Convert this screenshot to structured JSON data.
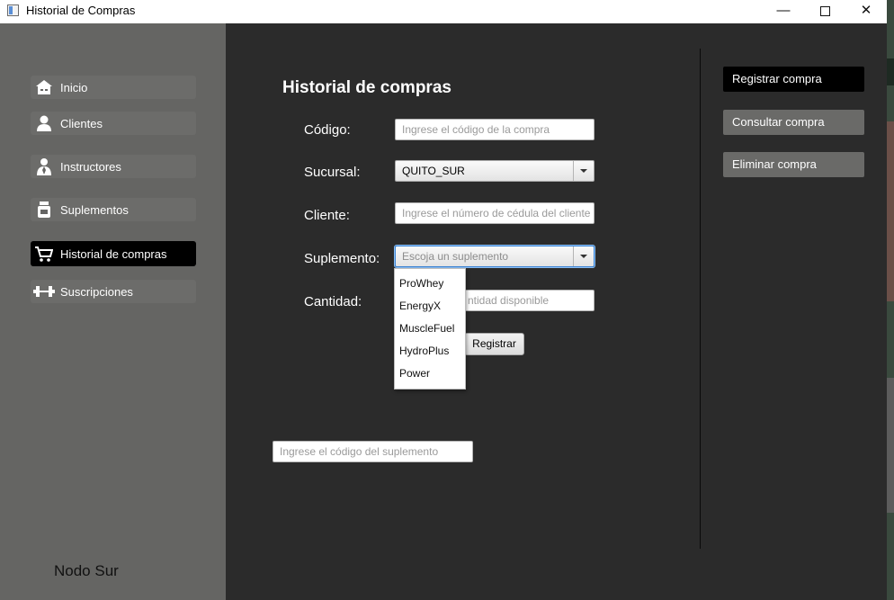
{
  "window": {
    "title": "Historial de Compras",
    "controls": {
      "minimize": "—",
      "close": "✕"
    }
  },
  "sidebar": {
    "items": [
      {
        "label": "Inicio",
        "icon": "home-icon",
        "active": false
      },
      {
        "label": "Clientes",
        "icon": "user-icon",
        "active": false
      },
      {
        "label": "Instructores",
        "icon": "instructor-icon",
        "active": false
      },
      {
        "label": "Suplementos",
        "icon": "supplement-jar-icon",
        "active": false
      },
      {
        "label": "Historial de compras",
        "icon": "cart-icon",
        "active": true
      },
      {
        "label": "Suscripciones",
        "icon": "dumbbell-icon",
        "active": false
      }
    ],
    "footer": "Nodo Sur"
  },
  "form": {
    "title": "Historial de compras",
    "codigo": {
      "label": "Código:",
      "placeholder": "Ingrese el código de la compra"
    },
    "sucursal": {
      "label": "Sucursal:",
      "value": "QUITO_SUR"
    },
    "cliente": {
      "label": "Cliente:",
      "placeholder": "Ingrese el número de cédula del cliente"
    },
    "suplemento": {
      "label": "Suplemento:",
      "placeholder": "Escoja un suplemento",
      "options": [
        "ProWhey",
        "EnergyX",
        "MuscleFuel",
        "HydroPlus",
        "Power"
      ]
    },
    "cantidad": {
      "label": "Cantidad:",
      "placeholder_visible": "ntidad disponible"
    },
    "submit": "Registrar",
    "codigo_suplemento": {
      "placeholder": "Ingrese el código del suplemento"
    }
  },
  "actions": {
    "registrar": "Registrar compra",
    "consultar": "Consultar compra",
    "eliminar": "Eliminar compra"
  },
  "colors": {
    "sidebar_bg": "#656563",
    "main_bg": "#2b2b2b",
    "active_item": "#000000",
    "button_gray": "#6a6a68"
  }
}
